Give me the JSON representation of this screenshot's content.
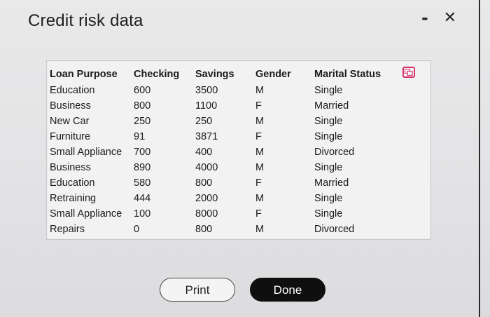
{
  "dialog": {
    "title": "Credit risk data",
    "minimize_label": "-",
    "close_label": "✕"
  },
  "table": {
    "headers": [
      "Loan Purpose",
      "Checking",
      "Savings",
      "Gender",
      "Marital Status"
    ],
    "rows": [
      [
        "Education",
        "600",
        "3500",
        "M",
        "Single"
      ],
      [
        "Business",
        "800",
        "1100",
        "F",
        "Married"
      ],
      [
        "New Car",
        "250",
        "250",
        "M",
        "Single"
      ],
      [
        "Furniture",
        "91",
        "3871",
        "F",
        "Single"
      ],
      [
        "Small Appliance",
        "700",
        "400",
        "M",
        "Divorced"
      ],
      [
        "Business",
        "890",
        "4000",
        "M",
        "Single"
      ],
      [
        "Education",
        "580",
        "800",
        "F",
        "Married"
      ],
      [
        "Retraining",
        "444",
        "2000",
        "M",
        "Single"
      ],
      [
        "Small Appliance",
        "100",
        "8000",
        "F",
        "Single"
      ],
      [
        "Repairs",
        "0",
        "800",
        "M",
        "Divorced"
      ]
    ],
    "copy_icon": "copy-icon",
    "copy_icon_color": "#d3336a"
  },
  "footer": {
    "print_label": "Print",
    "done_label": "Done"
  }
}
